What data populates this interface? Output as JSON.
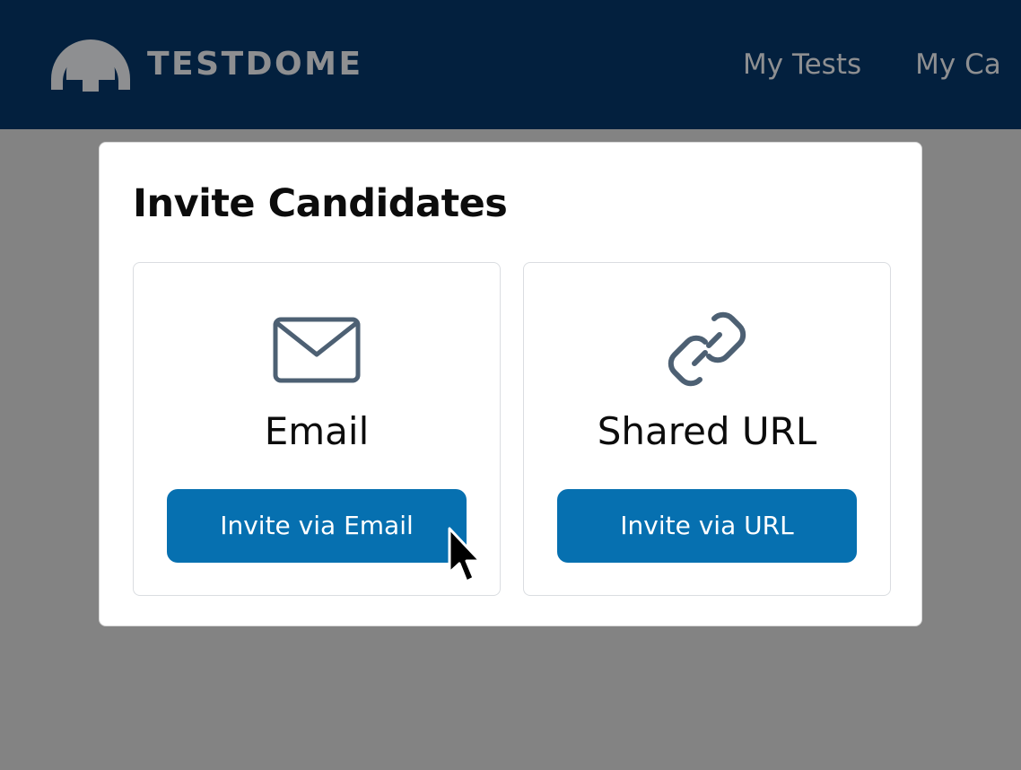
{
  "header": {
    "logo_text": "TESTDOME",
    "nav": [
      {
        "label": "My Tests"
      },
      {
        "label": "My Ca"
      }
    ]
  },
  "modal": {
    "title": "Invite Candidates",
    "cards": [
      {
        "icon": "envelope-icon",
        "label": "Email",
        "button_label": "Invite via Email"
      },
      {
        "icon": "link-icon",
        "label": "Shared URL",
        "button_label": "Invite via URL"
      }
    ]
  },
  "colors": {
    "header_bg": "#03203e",
    "overlay_bg": "#838383",
    "primary_button": "#0670b0",
    "icon_stroke": "#4d6073",
    "logo_gray": "#8e8f91"
  }
}
